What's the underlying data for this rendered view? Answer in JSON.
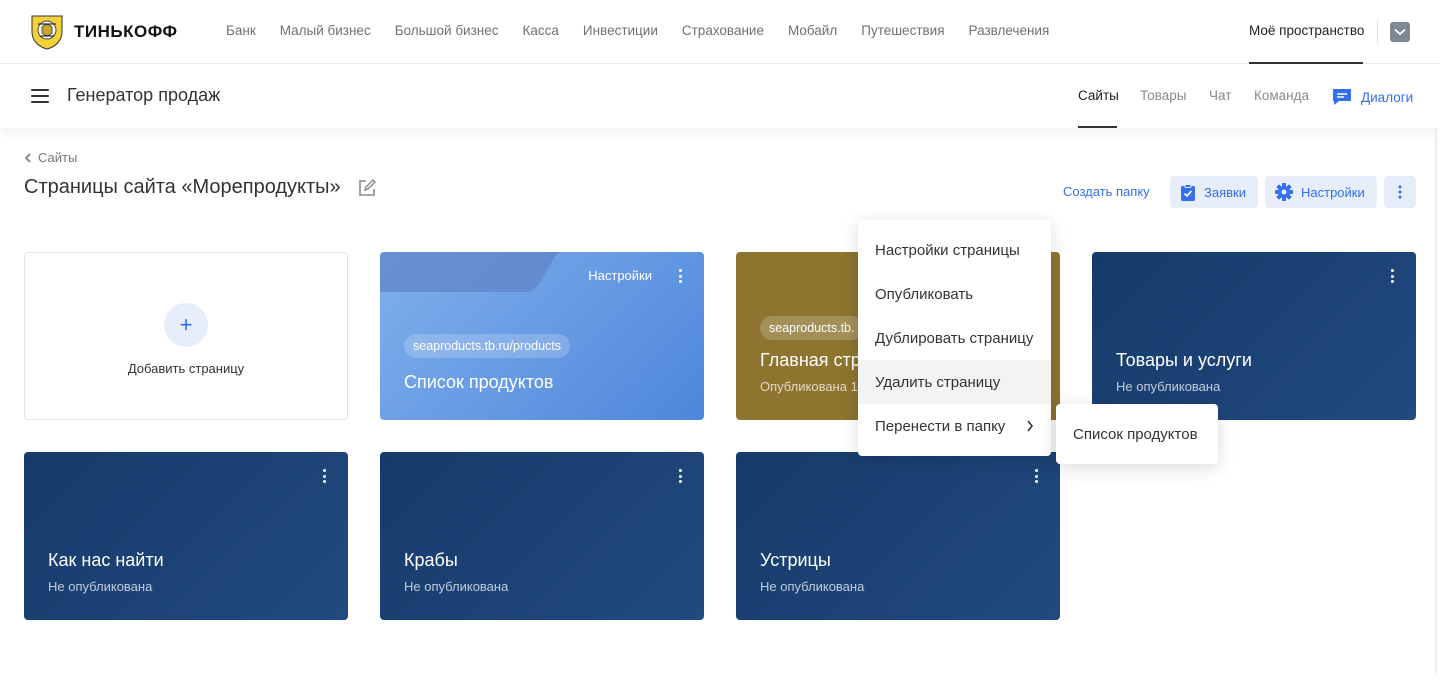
{
  "brand": {
    "name": "ТИНЬКОФФ"
  },
  "top_nav": [
    "Банк",
    "Малый бизнес",
    "Большой бизнес",
    "Касса",
    "Инвестиции",
    "Страхование",
    "Мобайл",
    "Путешествия",
    "Развлечения"
  ],
  "my_space": "Моё пространство",
  "app": {
    "title": "Генератор продаж",
    "tabs": [
      {
        "label": "Сайты",
        "active": true
      },
      {
        "label": "Товары",
        "active": false
      },
      {
        "label": "Чат",
        "active": false
      },
      {
        "label": "Команда",
        "active": false
      }
    ],
    "dialogs": "Диалоги"
  },
  "breadcrumb": "Сайты",
  "page_title": "Страницы сайта «Морепродукты»",
  "actions": {
    "create_folder": "Создать папку",
    "requests": "Заявки",
    "settings": "Настройки"
  },
  "add_page": "Добавить страницу",
  "cards": [
    {
      "title": "Список продуктов",
      "url": "seaproducts.tb.ru/products",
      "settings": "Настройки",
      "style": "folder"
    },
    {
      "title": "Главная стра",
      "url": "seaproducts.tb.",
      "status": "Опубликована 1",
      "style": "published"
    },
    {
      "title": "Товары и услуги",
      "status": "Не опубликована",
      "style": "draft"
    },
    {
      "title": "Как нас найти",
      "status": "Не опубликована",
      "style": "draft"
    },
    {
      "title": "Крабы",
      "status": "Не опубликована",
      "style": "draft"
    },
    {
      "title": "Устрицы",
      "status": "Не опубликована",
      "style": "draft"
    }
  ],
  "context_menu": [
    "Настройки страницы",
    "Опубликовать",
    "Дублировать страницу",
    "Удалить страницу",
    "Перенести в папку"
  ],
  "submenu": [
    "Список продуктов"
  ],
  "colors": {
    "accent": "#336fee",
    "navy": "#163a6b",
    "gold": "#8d7530",
    "light_blue": "#6a9be4"
  }
}
